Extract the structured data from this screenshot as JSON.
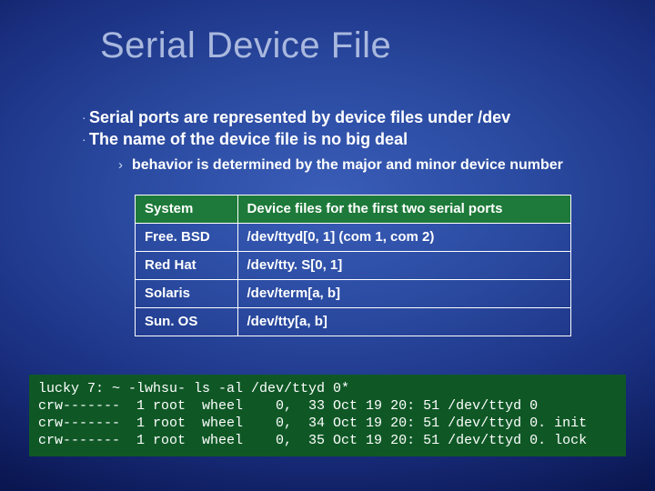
{
  "title": "Serial Device File",
  "bullets": [
    "Serial ports are represented by device files under /dev",
    "The name of the device file is no big deal"
  ],
  "subbullet": "behavior is determined by the major and minor device number",
  "table": {
    "headers": [
      "System",
      "Device files for the first two serial ports"
    ],
    "rows": [
      [
        "Free. BSD",
        "/dev/ttyd[0, 1] (com 1, com 2)"
      ],
      [
        "Red Hat",
        "/dev/tty. S[0, 1]"
      ],
      [
        "Solaris",
        "/dev/term[a, b]"
      ],
      [
        "Sun. OS",
        "/dev/tty[a, b]"
      ]
    ]
  },
  "terminal_lines": [
    "lucky 7: ~ -lwhsu- ls -al /dev/ttyd 0*",
    "crw-------  1 root  wheel    0,  33 Oct 19 20: 51 /dev/ttyd 0",
    "crw-------  1 root  wheel    0,  34 Oct 19 20: 51 /dev/ttyd 0. init",
    "crw-------  1 root  wheel    0,  35 Oct 19 20: 51 /dev/ttyd 0. lock"
  ]
}
